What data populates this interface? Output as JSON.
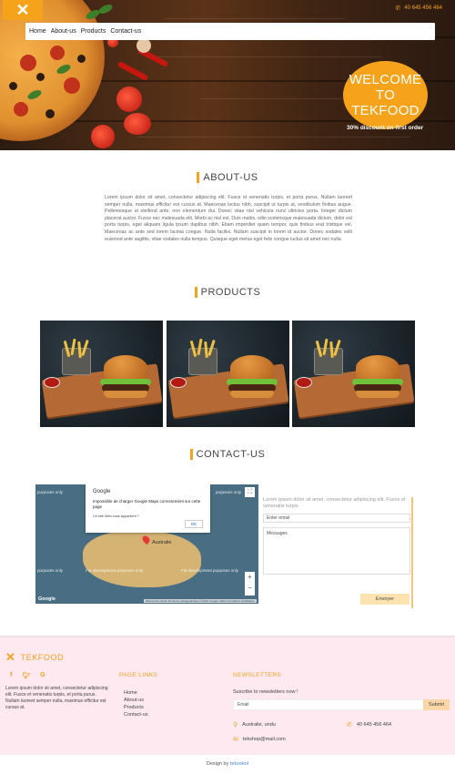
{
  "header": {
    "menu_icon": "close-x-icon",
    "phone": "40 645 456 464",
    "nav": [
      "Home",
      "About-us",
      "Products",
      "Contact-us"
    ],
    "welcome_lines": [
      "WELCOME",
      "TO",
      "TEKFOOD"
    ],
    "discount": "30% discount on first order"
  },
  "about": {
    "title": "ABOUT-US",
    "text": "Lorem ipsum dolor sit amet, consectetur adipiscing elit. Fusce et venenatis turpis, et porta purus. Nullam laoreet semper nulla, maximus efficitur est cursus at. Maecenas luctus nibh, suscipit ut turpis at, vestibulum finibus augue. Pellentesque ut eleifend ante, non elementum dui. Donec vitae nisl vehicula nunc ultricies porta. Integer dictum placerat auctor. Fusce nec malesuada elit. Morbi ac nisl est. Duis mattis, odio scelerisque malesuada dictum, dolor est porta turpis, eget aliquam ligula ipsum dapibus nibh. Etiam imperdiet quam tempor, quis finibus erat tristique vel. Maecenas ac ante sed lorem lacinia congue. Nulla facilisi. Nullam suscipit in lorem id auctor. Donec sodales velit euismod ante sagittis, vitae sodales nulla tempus. Quisque eget metus eget felis congue luctus sit amet nec nulla."
  },
  "products": {
    "title": "PRODUCTS",
    "items": [
      "burger-fries-image",
      "burger-fries-image",
      "burger-fries-image"
    ]
  },
  "contact": {
    "title": "CONTACT-US",
    "map": {
      "dialog_brand": "Google",
      "dialog_message": "Impossible de charger Google Maps correctement sur cette page",
      "dialog_question": "Ce site Web vous appartient ?",
      "dialog_ok": "OK",
      "watermark": "For development purposes only",
      "watermark_short": "purposes only",
      "region_label": "Australie",
      "logo": "Google",
      "attribution": "Raccourcis clavier  Données cartographiques ©2022 Google, INEGI  Conditions d'utilisation",
      "zoom_in": "+",
      "zoom_out": "−"
    },
    "lead": "Lorem ipsum dolor sit amet, consectetur adipiscing elit. Fusce et venenatis turpis.",
    "email_placeholder": "Enter email",
    "message_placeholder": "Messages",
    "send_label": "Envoyer"
  },
  "footer": {
    "brand": "TEKFOOD",
    "social": [
      "f",
      "t",
      "G"
    ],
    "text": "Lorem ipsum dolor sit amet, consectetur adipiscing elit. Fusce et venenatis turpis, et porta purus. Nullam laoreet semper nulla, maximus efficitur est cursus at.",
    "links_title": "PAGE LINKS",
    "links": [
      "Home",
      "About-us",
      "Products",
      "Contact-us"
    ],
    "news_title": "NEWSLETTERS",
    "news_text": "Suscribe to newsletters now !",
    "email_placeholder": "Email",
    "submit_label": "Submit",
    "location": "Australie, undu",
    "phone": "40 645 456 464",
    "email": "tekshop@mail.com",
    "design_prefix": "Design by",
    "design_author": "tekzekol"
  },
  "colors": {
    "accent": "#f7a21b",
    "footer_bg": "#fde9ef",
    "send_bg": "#fde3b0"
  }
}
